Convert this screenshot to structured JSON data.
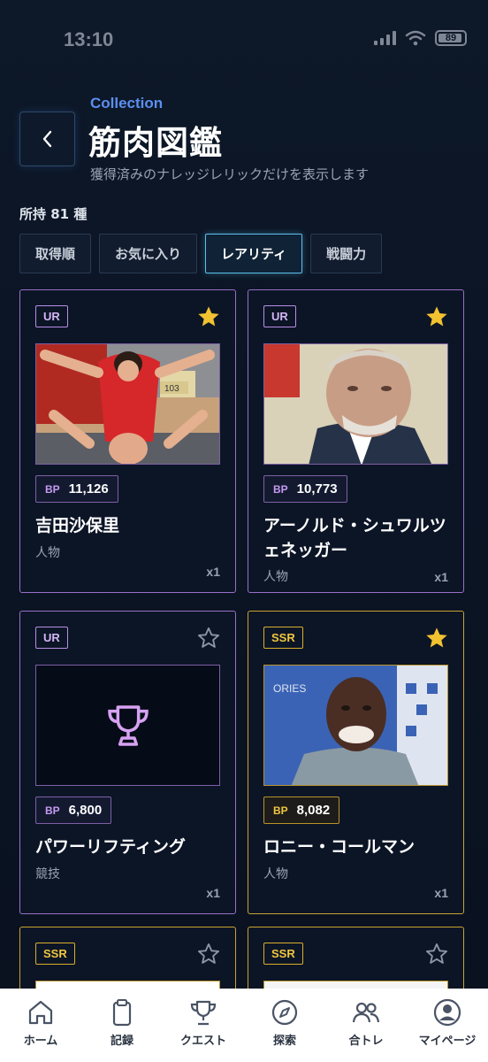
{
  "status_bar": {
    "time": "13:10",
    "battery": "89"
  },
  "header": {
    "eyebrow": "Collection",
    "title": "筋肉図鑑",
    "subtitle": "獲得済みのナレッジレリックだけを表示します"
  },
  "owned_count": "所持 81 種",
  "sort_tabs": [
    {
      "label": "取得順",
      "active": false
    },
    {
      "label": "お気に入り",
      "active": false
    },
    {
      "label": "レアリティ",
      "active": true
    },
    {
      "label": "戦闘力",
      "active": false
    }
  ],
  "cards": [
    {
      "rarity": "UR",
      "favorite": true,
      "bp_label": "BP",
      "bp": "11,126",
      "name": "吉田沙保里",
      "category": "人物",
      "qty": "x1",
      "image": "photo-wrestling"
    },
    {
      "rarity": "UR",
      "favorite": true,
      "bp_label": "BP",
      "bp": "10,773",
      "name": "アーノルド・シュワルツェネッガー",
      "category": "人物",
      "qty": "x1",
      "image": "photo-portrait"
    },
    {
      "rarity": "UR",
      "favorite": false,
      "bp_label": "BP",
      "bp": "6,800",
      "name": "パワーリフティング",
      "category": "競技",
      "qty": "x1",
      "image": "trophy-icon"
    },
    {
      "rarity": "SSR",
      "favorite": true,
      "bp_label": "BP",
      "bp": "8,082",
      "name": "ロニー・コールマン",
      "category": "人物",
      "qty": "x1",
      "image": "photo-bodybuilder"
    },
    {
      "rarity": "SSR",
      "favorite": false
    },
    {
      "rarity": "SSR",
      "favorite": false
    }
  ],
  "bottom_nav": [
    {
      "label": "ホーム",
      "icon": "home-icon"
    },
    {
      "label": "記録",
      "icon": "clipboard-icon"
    },
    {
      "label": "クエスト",
      "icon": "trophy-icon"
    },
    {
      "label": "探索",
      "icon": "compass-icon"
    },
    {
      "label": "合トレ",
      "icon": "users-icon"
    },
    {
      "label": "マイページ",
      "icon": "user-circle-icon"
    }
  ],
  "colors": {
    "ur": "#9a6fc7",
    "ssr": "#c9a230",
    "accent_blue": "#5b8ff0",
    "star_gold": "#f2c230",
    "background": "#0b1424"
  }
}
